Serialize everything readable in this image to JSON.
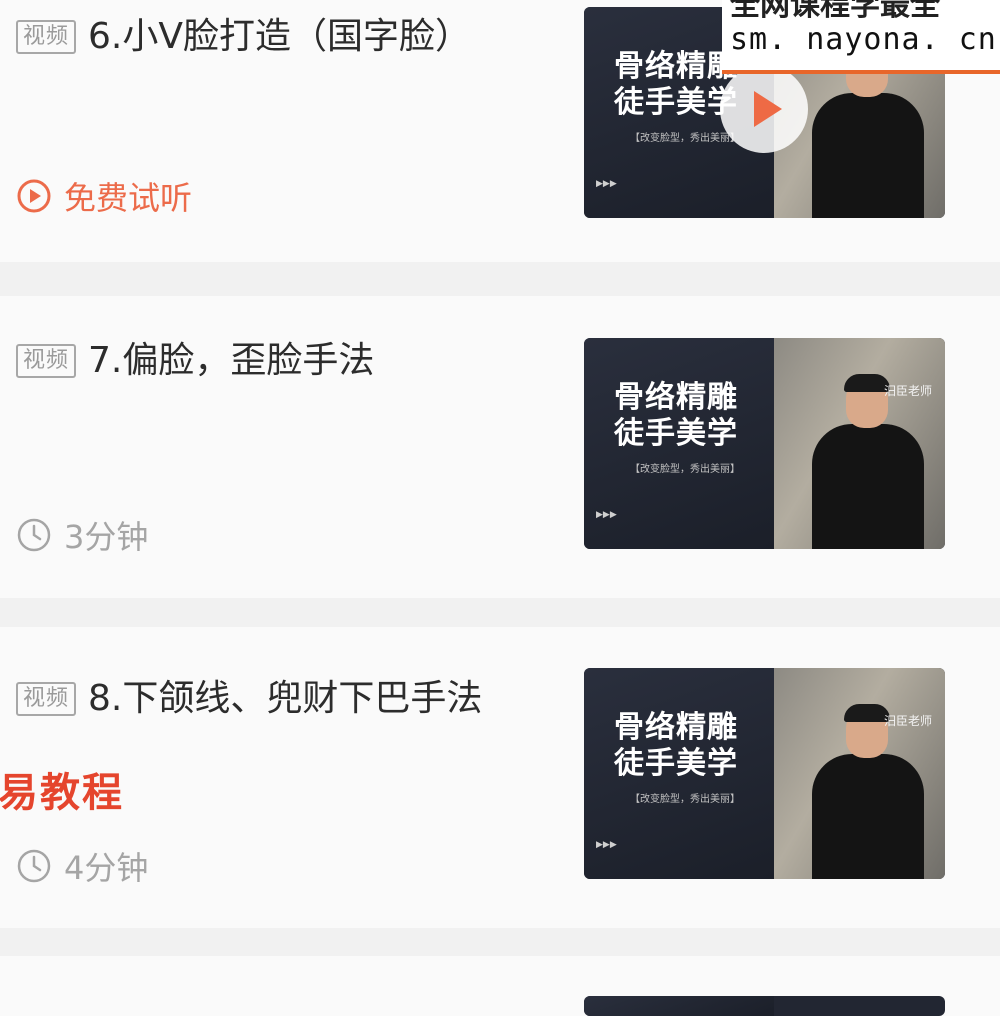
{
  "lessons": [
    {
      "tag": "视频",
      "title": "6.小V脸打造（国字脸）",
      "meta_label": "免费试听",
      "meta_icon": "play-circle-icon",
      "meta_color": "#ec6b4a",
      "thumb": {
        "title_line1": "骨络精雕",
        "title_line2": "徒手美学",
        "subtitle": "【改变脸型，秀出美丽】",
        "has_play": true
      }
    },
    {
      "tag": "视频",
      "title": "7.偏脸，歪脸手法",
      "meta_label": "3分钟",
      "meta_icon": "clock-icon",
      "meta_color": "#a5a5a5",
      "thumb": {
        "title_line1": "骨络精雕",
        "title_line2": "徒手美学",
        "subtitle": "【改变脸型，秀出美丽】",
        "teacher": "汨臣老师",
        "has_play": false
      }
    },
    {
      "tag": "视频",
      "title": "8.下颌线、兜财下巴手法",
      "meta_label": "4分钟",
      "meta_icon": "clock-icon",
      "meta_color": "#a5a5a5",
      "thumb": {
        "title_line1": "骨络精雕",
        "title_line2": "徒手美学",
        "subtitle": "【改变脸型，秀出美丽】",
        "teacher": "汨臣老师",
        "has_play": false
      }
    }
  ],
  "watermark": {
    "top_line1": "全网课程学最全",
    "top_line2": "sm. nayona. cn",
    "left_text": "易教程"
  },
  "colors": {
    "accent": "#ec6b4a",
    "watermark_red": "#e5452d",
    "watermark_orange": "#e8662a"
  }
}
